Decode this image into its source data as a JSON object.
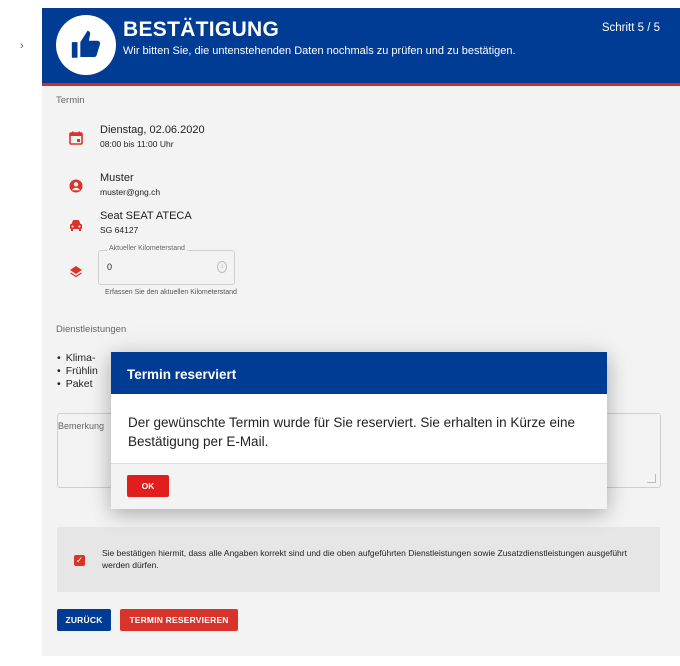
{
  "header": {
    "title": "BESTÄTIGUNG",
    "subtitle": "Wir bitten Sie, die untenstehenden Daten nochmals zu prüfen und zu bestätigen.",
    "step": "Schritt 5 / 5",
    "icon": "thumbs-up-icon",
    "colors": {
      "primary": "#003b94",
      "accent": "#d9342b"
    }
  },
  "sections": {
    "termin_label": "Termin",
    "services_label": "Dienstleistungen"
  },
  "appointment": {
    "date": "Dienstag, 02.06.2020",
    "time": "08:00 bis 11:00 Uhr"
  },
  "customer": {
    "name": "Muster",
    "email": "muster@gng.ch"
  },
  "vehicle": {
    "model": "Seat SEAT ATECA",
    "plate": "SG 64127"
  },
  "mileage": {
    "label": "Aktueller Kilometerstand",
    "value": "0",
    "help": "Erfassen Sie den aktuellen Kilometerstand"
  },
  "services": [
    "Klima-",
    "Frühlin",
    "Paket"
  ],
  "remarks": {
    "label": "Bemerkung"
  },
  "confirmation": {
    "checked": true,
    "text": "Sie bestätigen hiermit, dass alle Angaben korrekt sind und die oben aufgeführten Dienstleistungen sowie Zusatzdienstleistungen ausgeführt werden dürfen."
  },
  "buttons": {
    "back": "ZURÜCK",
    "reserve": "TERMIN RESERVIEREN"
  },
  "modal": {
    "title": "Termin reserviert",
    "body": "Der gewünschte Termin wurde für Sie reserviert. Sie erhalten in Kürze eine Bestätigung per E-Mail.",
    "ok": "OK"
  }
}
